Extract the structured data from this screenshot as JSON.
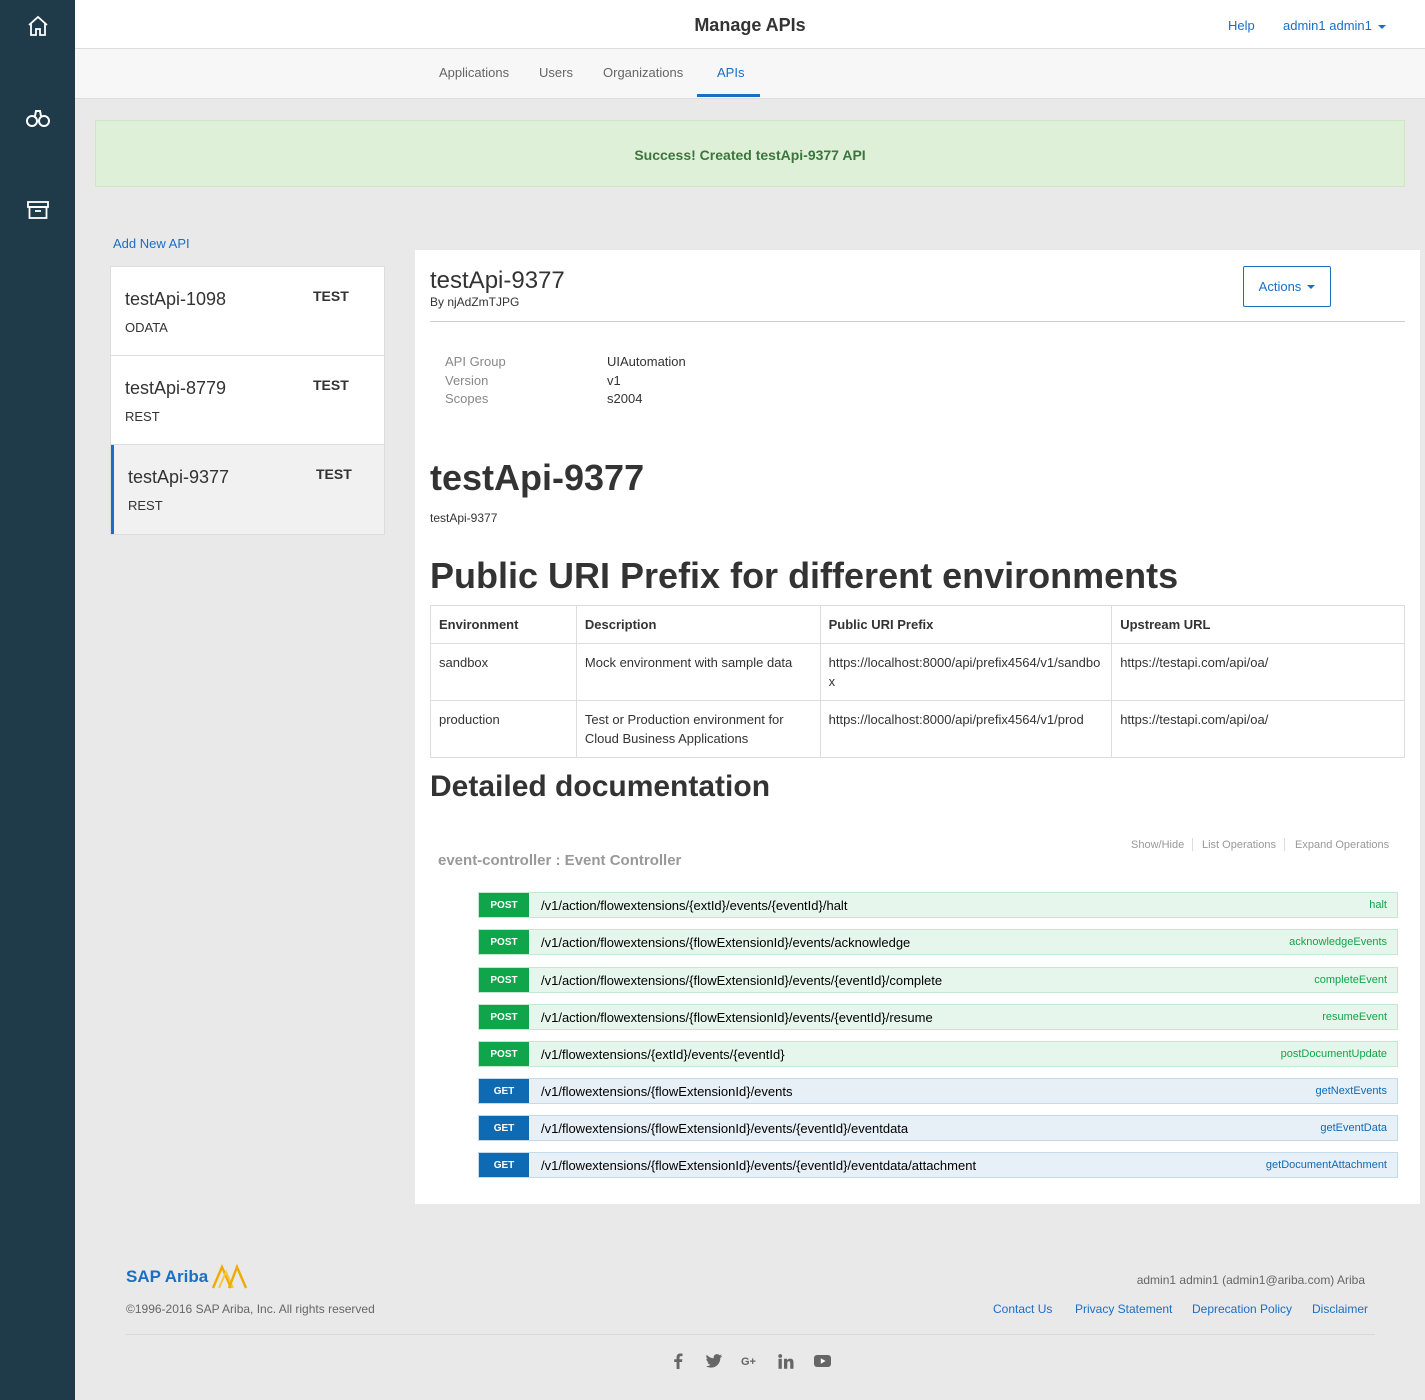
{
  "header": {
    "title": "Manage APIs",
    "help": "Help",
    "user": "admin1 admin1"
  },
  "tabs": [
    {
      "label": "Applications"
    },
    {
      "label": "Users"
    },
    {
      "label": "Organizations"
    },
    {
      "label": "APIs",
      "active": true
    }
  ],
  "alert": "Success! Created testApi-9377 API",
  "add_new_api": "Add New API",
  "api_list": [
    {
      "name": "testApi-1098",
      "tag": "TEST",
      "type": "ODATA"
    },
    {
      "name": "testApi-8779",
      "tag": "TEST",
      "type": "REST"
    },
    {
      "name": "testApi-9377",
      "tag": "TEST",
      "type": "REST",
      "selected": true
    }
  ],
  "detail": {
    "title": "testApi-9377",
    "by": "By njAdZmTJPG",
    "actions_label": "Actions",
    "meta": [
      {
        "key": "API Group",
        "value": "UIAutomation"
      },
      {
        "key": "Version",
        "value": "v1"
      },
      {
        "key": "Scopes",
        "value": "s2004"
      }
    ],
    "heading": "testApi-9377",
    "subheading": "testApi-9377",
    "uri_heading": "Public URI Prefix for different environments",
    "table": {
      "headers": [
        "Environment",
        "Description",
        "Public URI Prefix",
        "Upstream URL"
      ],
      "rows": [
        [
          "sandbox",
          "Mock environment with sample data",
          "https://localhost:8000/api/prefix4564/v1/sandbox",
          "https://testapi.com/api/oa/"
        ],
        [
          "production",
          "Test or Production environment for Cloud Business Applications",
          "https://localhost:8000/api/prefix4564/v1/prod",
          "https://testapi.com/api/oa/"
        ]
      ]
    },
    "doc_heading": "Detailed documentation",
    "controller": "event-controller : Event Controller",
    "controls": [
      "Show/Hide",
      "List Operations",
      "Expand Operations"
    ],
    "operations": [
      {
        "method": "POST",
        "path": "/v1/action/flowextensions/{extId}/events/{eventId}/halt",
        "name": "halt"
      },
      {
        "method": "POST",
        "path": "/v1/action/flowextensions/{flowExtensionId}/events/acknowledge",
        "name": "acknowledgeEvents"
      },
      {
        "method": "POST",
        "path": "/v1/action/flowextensions/{flowExtensionId}/events/{eventId}/complete",
        "name": "completeEvent"
      },
      {
        "method": "POST",
        "path": "/v1/action/flowextensions/{flowExtensionId}/events/{eventId}/resume",
        "name": "resumeEvent"
      },
      {
        "method": "POST",
        "path": "/v1/flowextensions/{extId}/events/{eventId}",
        "name": "postDocumentUpdate"
      },
      {
        "method": "GET",
        "path": "/v1/flowextensions/{flowExtensionId}/events",
        "name": "getNextEvents"
      },
      {
        "method": "GET",
        "path": "/v1/flowextensions/{flowExtensionId}/events/{eventId}/eventdata",
        "name": "getEventData"
      },
      {
        "method": "GET",
        "path": "/v1/flowextensions/{flowExtensionId}/events/{eventId}/eventdata/attachment",
        "name": "getDocumentAttachment"
      }
    ]
  },
  "footer": {
    "logo": "SAP Ariba",
    "copyright": "©1996-2016 SAP Ariba, Inc. All rights reserved",
    "user": "admin1 admin1 (admin1@ariba.com) Ariba",
    "links": [
      "Contact Us",
      "Privacy Statement",
      "Deprecation Policy",
      "Disclaimer"
    ],
    "social": [
      "facebook-icon",
      "twitter-icon",
      "google-plus-icon",
      "linkedin-icon",
      "youtube-icon"
    ]
  },
  "colors": {
    "accent": "#1a6fc4",
    "rail": "#1f3a48",
    "post": "#10a54a",
    "get": "#0f6ab4",
    "success_bg": "#dff0d8",
    "logo_gold": "#f0ab00"
  }
}
